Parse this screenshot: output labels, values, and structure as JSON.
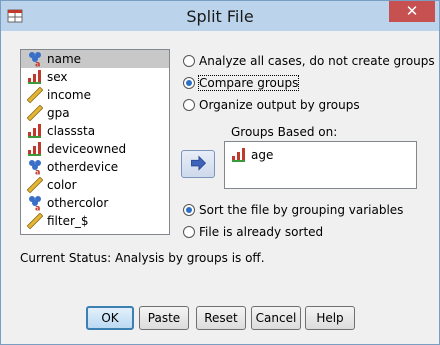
{
  "window": {
    "title": "Split File",
    "close_glyph": "✕"
  },
  "variables": [
    {
      "label": "name",
      "icon": "string-nominal-icon",
      "selected": true
    },
    {
      "label": "sex",
      "icon": "nominal-bars-icon"
    },
    {
      "label": "income",
      "icon": "scale-ruler-icon"
    },
    {
      "label": "gpa",
      "icon": "scale-ruler-icon"
    },
    {
      "label": "classsta",
      "icon": "nominal-bars-icon"
    },
    {
      "label": "deviceowned",
      "icon": "nominal-bars-icon"
    },
    {
      "label": "otherdevice",
      "icon": "string-nominal-icon"
    },
    {
      "label": "color",
      "icon": "scale-ruler-icon"
    },
    {
      "label": "othercolor",
      "icon": "string-nominal-icon"
    },
    {
      "label": "filter_$",
      "icon": "scale-ruler-icon"
    }
  ],
  "options": {
    "analyze_all": "Analyze all cases, do not create groups",
    "compare_groups": "Compare groups",
    "organize_output": "Organize output by groups",
    "selected": "compare_groups"
  },
  "groups": {
    "label": "Groups Based on:",
    "items": [
      "age"
    ]
  },
  "sort": {
    "sort_by_grouping": "Sort the file by grouping variables",
    "already_sorted": "File is already sorted",
    "selected": "sort_by_grouping"
  },
  "status": "Current Status: Analysis by groups is off.",
  "buttons": {
    "ok": "OK",
    "paste": "Paste",
    "reset": "Reset",
    "cancel": "Cancel",
    "help": "Help"
  },
  "colors": {
    "titlebar": "#bcd3ec",
    "close": "#c75050",
    "radio_dot": "#2d6fc4",
    "selection": "#c8c8c8"
  }
}
